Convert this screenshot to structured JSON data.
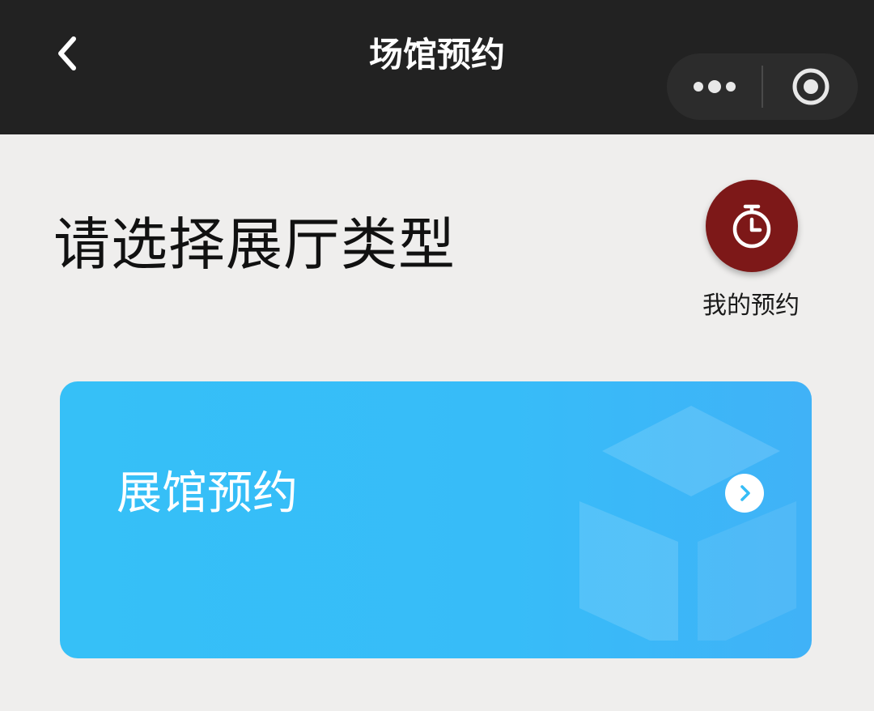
{
  "nav": {
    "title": "场馆预约",
    "back_icon": "chevron-left-icon",
    "capsule_icons": [
      "more-dots-icon",
      "target-circle-icon"
    ]
  },
  "page": {
    "heading": "请选择展厅类型"
  },
  "my_booking": {
    "label": "我的预约",
    "icon": "stopwatch-icon",
    "color": "#7d1818"
  },
  "cards": [
    {
      "label": "展馆预约",
      "icon": "cube-icon",
      "arrow_icon": "chevron-right-circle-icon",
      "color": "#36c0f7"
    }
  ]
}
